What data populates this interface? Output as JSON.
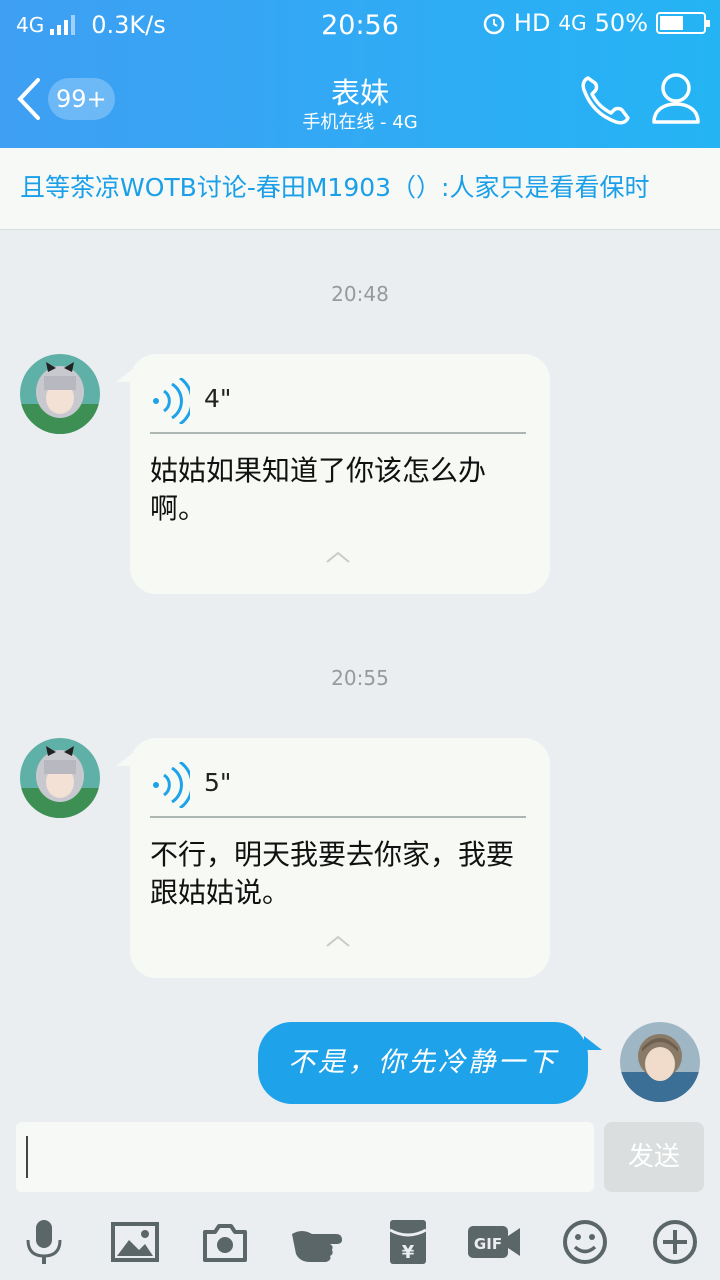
{
  "status_bar": {
    "network": "4G",
    "speed": "0.3K/s",
    "time": "20:56",
    "hd": "HD",
    "network_right": "4G",
    "battery": "50%"
  },
  "nav": {
    "unread": "99+",
    "title": "表妹",
    "subtitle": "手机在线 - 4G"
  },
  "topic_banner": "且等茶凉WOTB讨论-春田M1903（）:人家只是看看保时",
  "messages": [
    {
      "time": "20:48",
      "duration": "4\"",
      "text": "姑姑如果知道了你该怎么办啊。"
    },
    {
      "time": "20:55",
      "duration": "5\"",
      "text": "不行，明天我要去你家，我要跟姑姑说。"
    }
  ],
  "outgoing": {
    "text": "不是，你先冷静一下"
  },
  "composer": {
    "input_value": "",
    "send_label": "发送"
  },
  "toolbar_icons": [
    "microphone-icon",
    "image-icon",
    "camera-icon",
    "poke-icon",
    "red-packet-icon",
    "gif-icon",
    "emoji-icon",
    "plus-icon"
  ],
  "colors": {
    "header_start": "#3f9ff3",
    "header_end": "#24b4f4",
    "accent": "#1ea2e9",
    "chat_bg": "#eaeef1"
  }
}
